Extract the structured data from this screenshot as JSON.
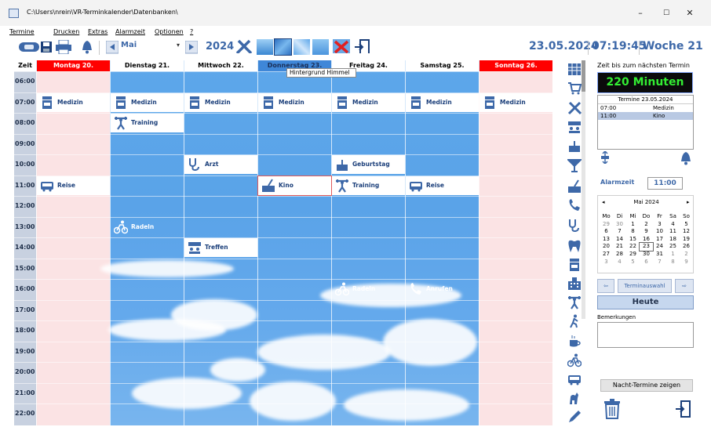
{
  "window": {
    "path": "C:\\Users\\nrein\\VR-Terminkalender\\Datenbanken\\",
    "minimize": "–",
    "maximize": "☐",
    "close": "✕"
  },
  "menu": [
    "Termine",
    "Drucken",
    "Extras",
    "Alarmzeit",
    "Optionen",
    "?"
  ],
  "toolbar": {
    "month": "Mai",
    "year": "2024",
    "date": "23.05.2024",
    "time": "07:19:45",
    "week": "Woche 21",
    "tooltip": "Hintergrund Himmel"
  },
  "calendar": {
    "time_header": "Zeit",
    "days": [
      {
        "label": "Montag 20.",
        "style": "red",
        "weekend": false
      },
      {
        "label": "Dienstag 21.",
        "style": "plain",
        "weekend": false
      },
      {
        "label": "Mittwoch 22.",
        "style": "plain",
        "weekend": false
      },
      {
        "label": "Donnerstag 23.",
        "style": "dark",
        "weekend": false
      },
      {
        "label": "Freitag 24.",
        "style": "plain",
        "weekend": false
      },
      {
        "label": "Samstag 25.",
        "style": "plain",
        "weekend": false
      },
      {
        "label": "Sonntag 26.",
        "style": "red",
        "weekend": true
      }
    ],
    "times": [
      "06:00",
      "07:00",
      "08:00",
      "09:00",
      "10:00",
      "11:00",
      "12:00",
      "13:00",
      "14:00",
      "15:00",
      "16:00",
      "17:00",
      "18:00",
      "19:00",
      "20:00",
      "21:00",
      "22:00"
    ],
    "events": [
      {
        "day": 0,
        "time": "07:00",
        "label": "Medizin",
        "icon": "medicine-icon"
      },
      {
        "day": 1,
        "time": "07:00",
        "label": "Medizin",
        "icon": "medicine-icon"
      },
      {
        "day": 2,
        "time": "07:00",
        "label": "Medizin",
        "icon": "medicine-icon"
      },
      {
        "day": 3,
        "time": "07:00",
        "label": "Medizin",
        "icon": "medicine-icon"
      },
      {
        "day": 4,
        "time": "07:00",
        "label": "Medizin",
        "icon": "medicine-icon"
      },
      {
        "day": 5,
        "time": "07:00",
        "label": "Medizin",
        "icon": "medicine-icon"
      },
      {
        "day": 6,
        "time": "07:00",
        "label": "Medizin",
        "icon": "medicine-icon"
      },
      {
        "day": 1,
        "time": "08:00",
        "label": "Training",
        "icon": "training-icon"
      },
      {
        "day": 2,
        "time": "10:00",
        "label": "Arzt",
        "icon": "stethoscope-icon"
      },
      {
        "day": 4,
        "time": "10:00",
        "label": "Geburtstag",
        "icon": "cake-icon"
      },
      {
        "day": 0,
        "time": "11:00",
        "label": "Reise",
        "icon": "bus-icon"
      },
      {
        "day": 3,
        "time": "11:00",
        "label": "Kino",
        "icon": "cinema-icon",
        "selected": true
      },
      {
        "day": 4,
        "time": "11:00",
        "label": "Training",
        "icon": "training-icon"
      },
      {
        "day": 5,
        "time": "11:00",
        "label": "Reise",
        "icon": "bus-icon"
      },
      {
        "day": 1,
        "time": "13:00",
        "label": "Radeln",
        "icon": "bicycle-icon",
        "clear": true
      },
      {
        "day": 2,
        "time": "14:00",
        "label": "Treffen",
        "icon": "meeting-icon"
      },
      {
        "day": 4,
        "time": "16:00",
        "label": "Radeln",
        "icon": "bicycle-icon",
        "clear": true
      },
      {
        "day": 5,
        "time": "16:00",
        "label": "Anrufen",
        "icon": "phone-icon",
        "clear": true
      }
    ]
  },
  "panel": {
    "next_label": "Zeit bis zum nächsten Termin",
    "minutes": "220 Minuten",
    "termine_header": "Termine  23.05.2024",
    "termine": [
      {
        "time": "07:00",
        "label": "Medizin",
        "selected": false
      },
      {
        "time": "11:00",
        "label": "Kino",
        "selected": true
      }
    ],
    "alarm_label": "Alarmzeit",
    "alarm_value": "11:00",
    "minical": {
      "month": "Mai 2024",
      "prev": "◂",
      "next": "▸",
      "weekdays": [
        "Mo",
        "Di",
        "Mi",
        "Do",
        "Fr",
        "Sa",
        "So"
      ],
      "weeks": [
        [
          "29",
          "30",
          "1",
          "2",
          "3",
          "4",
          "5"
        ],
        [
          "6",
          "7",
          "8",
          "9",
          "10",
          "11",
          "12"
        ],
        [
          "13",
          "14",
          "15",
          "16",
          "17",
          "18",
          "19"
        ],
        [
          "20",
          "21",
          "22",
          "23",
          "24",
          "25",
          "26"
        ],
        [
          "27",
          "28",
          "29",
          "30",
          "31",
          "1",
          "2"
        ],
        [
          "3",
          "4",
          "5",
          "6",
          "7",
          "8",
          "9"
        ]
      ],
      "today": "23"
    },
    "terminauswahl": "Terminauswahl",
    "heute": "Heute",
    "bemerkungen": "Bemerkungen",
    "nacht": "Nacht-Termine zeigen"
  },
  "colors": {
    "accent": "#3d68a8",
    "weekend": "#fbe3e4",
    "red": "#ff0000",
    "counter_text": "#33ee33"
  }
}
